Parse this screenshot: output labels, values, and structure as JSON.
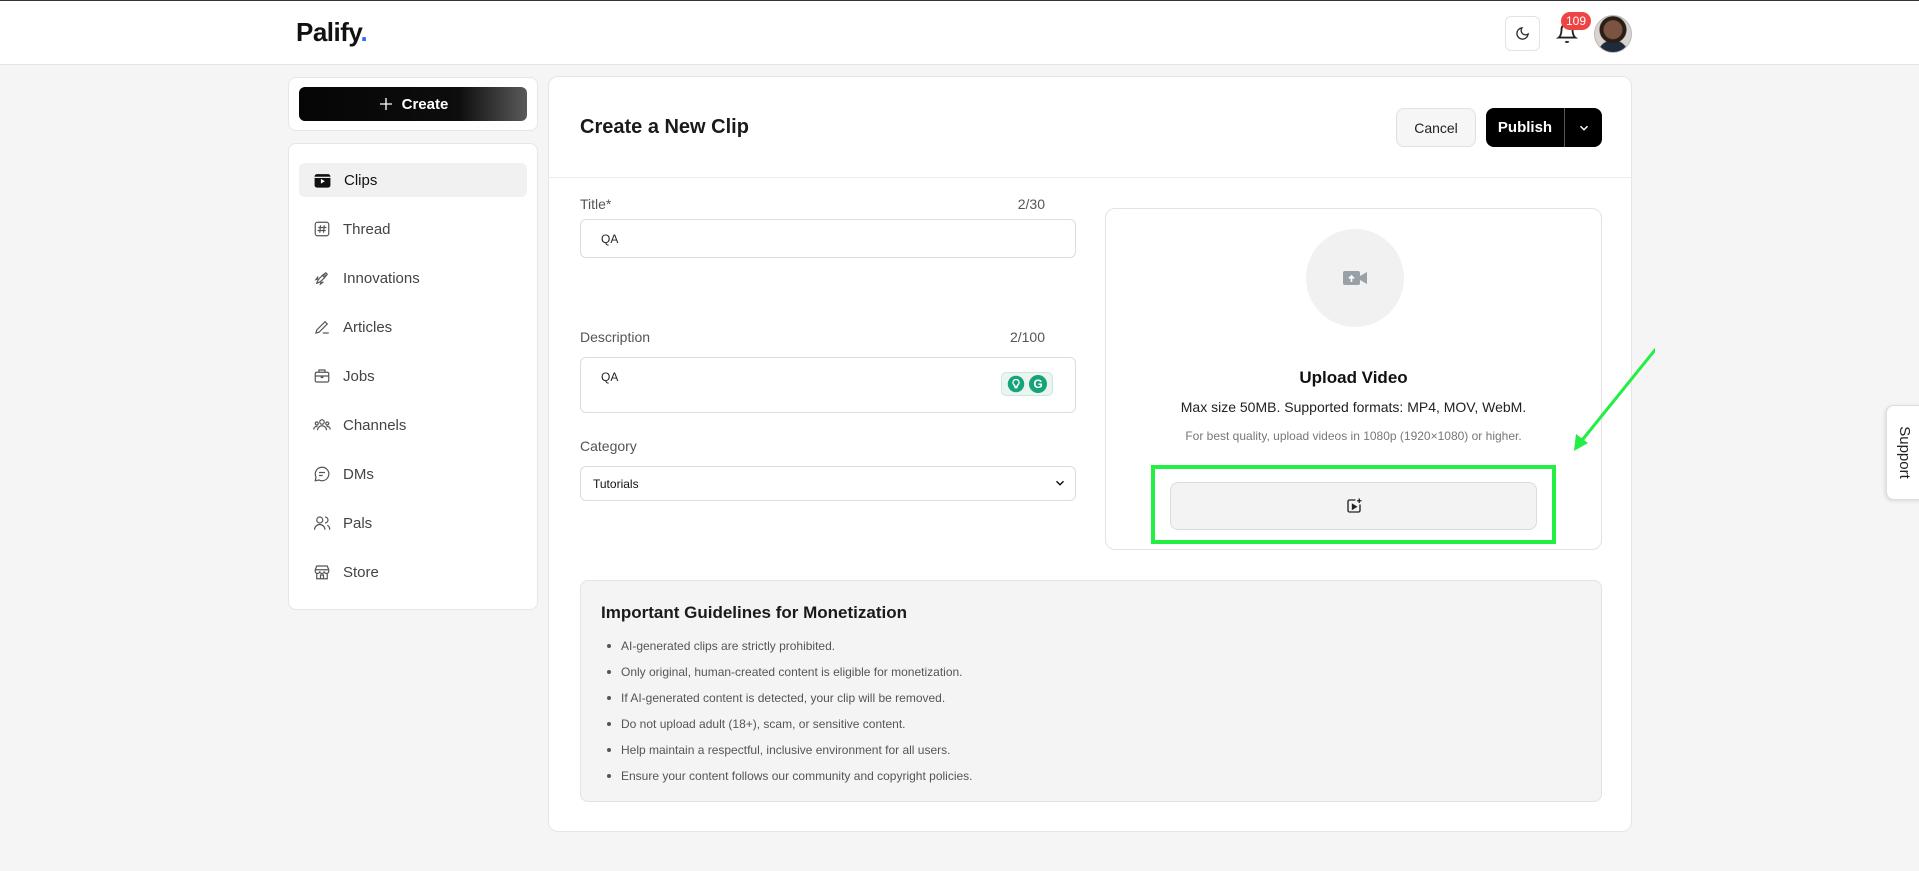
{
  "app": {
    "logo": "Palify",
    "logo_dot": ".",
    "notifications_count": "109"
  },
  "sidebar": {
    "create_label": "Create",
    "items": [
      {
        "label": "Clips",
        "icon": "clips-icon",
        "active": true
      },
      {
        "label": "Thread",
        "icon": "hash-icon"
      },
      {
        "label": "Innovations",
        "icon": "rocket-icon"
      },
      {
        "label": "Articles",
        "icon": "pencil-icon"
      },
      {
        "label": "Jobs",
        "icon": "briefcase-icon"
      },
      {
        "label": "Channels",
        "icon": "users-icon"
      },
      {
        "label": "DMs",
        "icon": "chat-icon"
      },
      {
        "label": "Pals",
        "icon": "user-icon"
      },
      {
        "label": "Store",
        "icon": "store-icon"
      }
    ]
  },
  "main": {
    "title": "Create a New Clip",
    "cancel_label": "Cancel",
    "publish_label": "Publish",
    "form": {
      "title_label": "Title*",
      "title_count": "2/30",
      "title_value": "QA",
      "description_label": "Description",
      "description_count": "2/100",
      "description_value": "QA",
      "category_label": "Category",
      "category_value": "Tutorials"
    },
    "upload": {
      "title": "Upload Video",
      "subtitle": "Max size 50MB. Supported formats: MP4, MOV, WebM.",
      "hint": "For best quality, upload videos in 1080p (1920×1080) or higher."
    },
    "guidelines": {
      "title": "Important Guidelines for Monetization",
      "items": [
        "AI-generated clips are strictly prohibited.",
        "Only original, human-created content is eligible for monetization.",
        "If AI-generated content is detected, your clip will be removed.",
        "Do not upload adult (18+), scam, or sensitive content.",
        "Help maintain a respectful, inclusive environment for all users.",
        "Ensure your content follows our community and copyright policies."
      ]
    }
  },
  "support_label": "Support",
  "colors": {
    "highlight": "#22ee44",
    "accent": "#2f6bff",
    "badge": "#ef4444"
  }
}
